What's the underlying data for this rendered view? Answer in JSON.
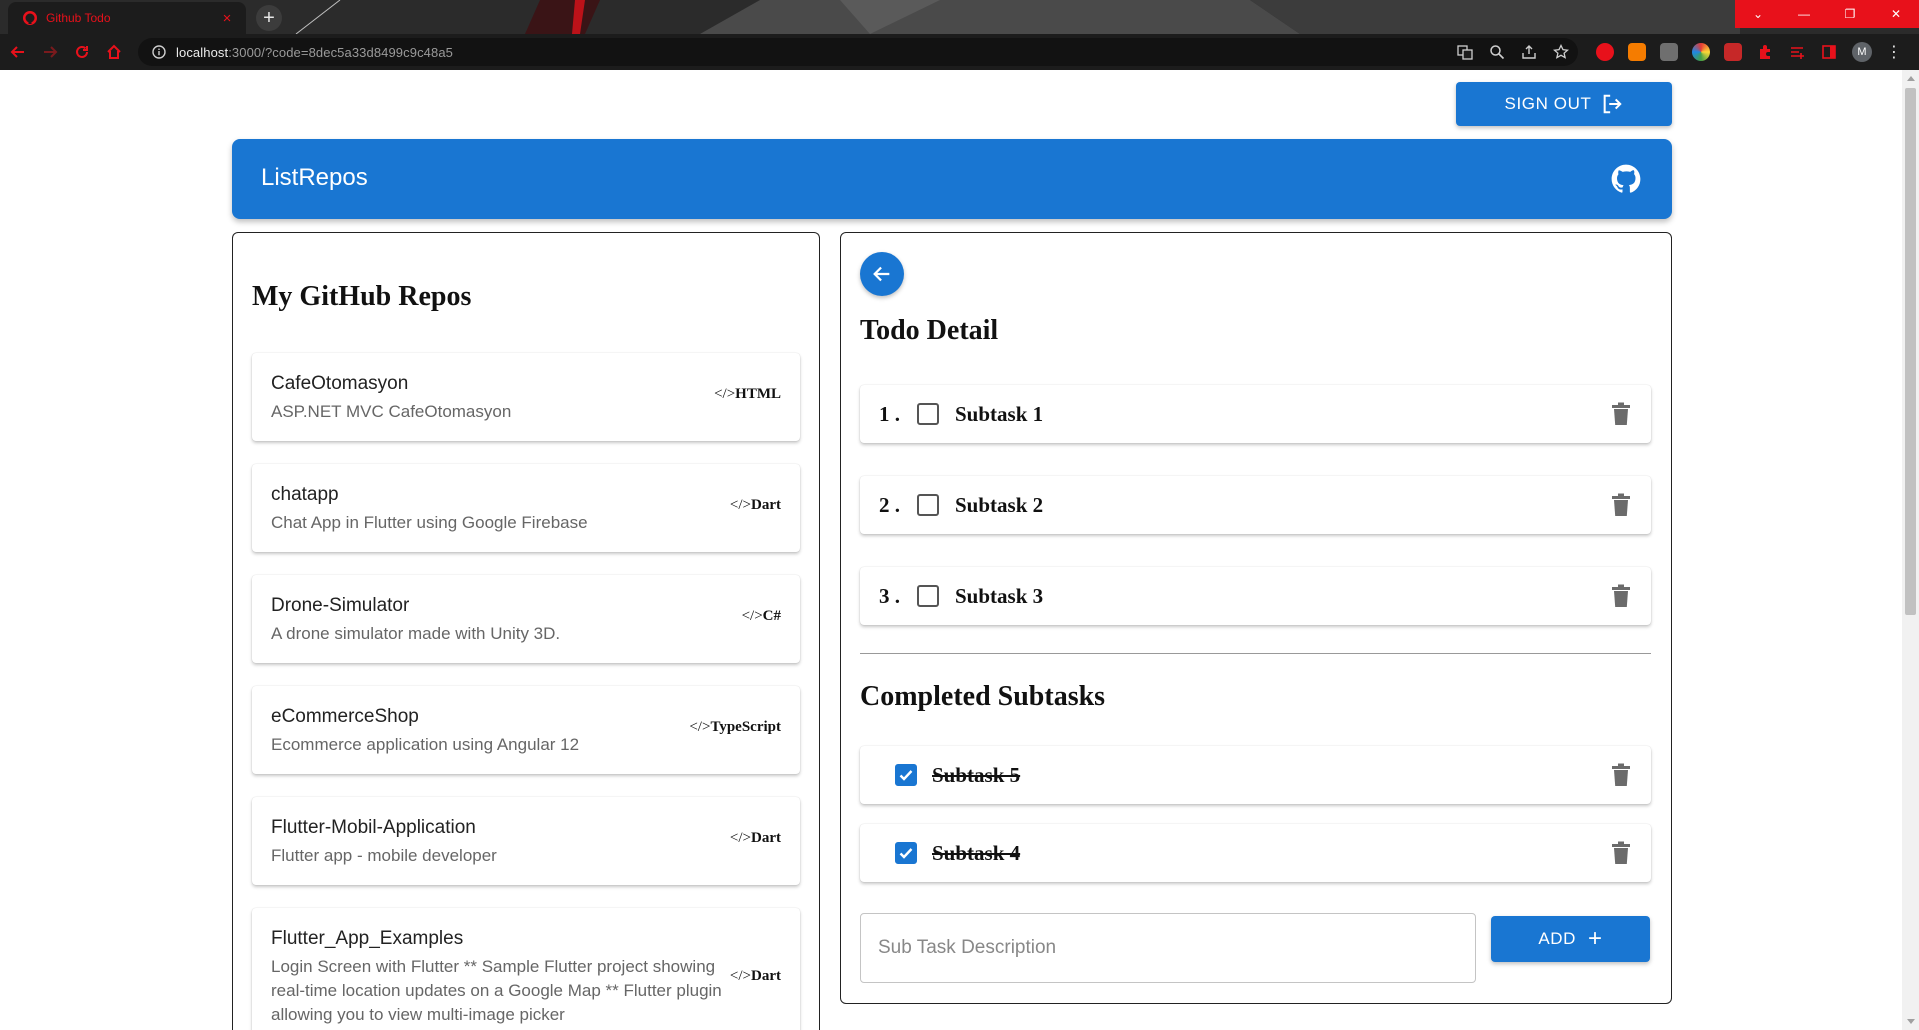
{
  "browser": {
    "tab_title": "Github Todo",
    "tab_close": "×",
    "new_tab": "+",
    "url_host": "localhost",
    "url_rest": ":3000/?code=8dec5a33d8499c9c48a5",
    "profile_initial": "M",
    "menu": "⋮",
    "window_controls": [
      "⌄",
      "—",
      "❐",
      "✕"
    ],
    "accent_color": "#e8111b"
  },
  "page": {
    "signout_label": "SIGN OUT",
    "app_title": "ListRepos",
    "primary_color": "#1976d2"
  },
  "repos": {
    "heading": "My GitHub Repos",
    "items": [
      {
        "name": "CafeOtomasyon",
        "description": "ASP.NET MVC CafeOtomasyon",
        "lang_prefix": "</>",
        "language": "HTML"
      },
      {
        "name": "chatapp",
        "description": "Chat App in Flutter using Google Firebase",
        "lang_prefix": "</>",
        "language": "Dart"
      },
      {
        "name": "Drone-Simulator",
        "description": "A drone simulator made with Unity 3D.",
        "lang_prefix": "</>",
        "language": "C#"
      },
      {
        "name": "eCommerceShop",
        "description": "Ecommerce application using Angular 12",
        "lang_prefix": "</>",
        "language": "TypeScript"
      },
      {
        "name": "Flutter-Mobil-Application",
        "description": "Flutter app - mobile developer",
        "lang_prefix": "</>",
        "language": "Dart"
      },
      {
        "name": "Flutter_App_Examples",
        "description": "Login Screen with Flutter ** Sample Flutter project showing real-time location updates on a Google Map ** Flutter plugin allowing you to view multi-image picker",
        "lang_prefix": "</>",
        "language": "Dart"
      }
    ]
  },
  "detail": {
    "heading": "Todo Detail",
    "open_tasks": [
      {
        "number": "1 .",
        "text": "Subtask 1",
        "checked": false
      },
      {
        "number": "2 .",
        "text": "Subtask 2",
        "checked": false
      },
      {
        "number": "3 .",
        "text": "Subtask 3",
        "checked": false
      }
    ],
    "completed_heading": "Completed Subtasks",
    "completed_tasks": [
      {
        "text": "Subtask 5",
        "checked": true
      },
      {
        "text": "Subtask 4",
        "checked": true
      }
    ],
    "input_placeholder": "Sub Task Description",
    "input_value": "",
    "add_label": "ADD",
    "add_icon": "+"
  }
}
